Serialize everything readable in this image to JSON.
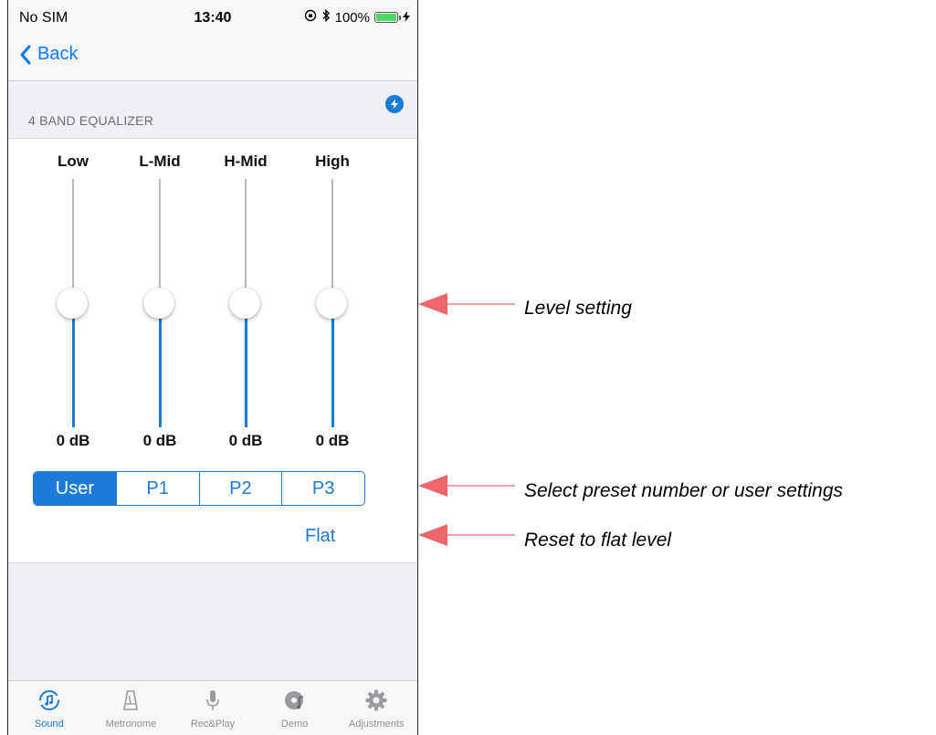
{
  "status_bar": {
    "carrier": "No SIM",
    "time": "13:40",
    "battery": "100%",
    "battery_level": 1.0
  },
  "nav": {
    "back_label": "Back"
  },
  "section": {
    "header": "4 BAND EQUALIZER"
  },
  "bands": [
    {
      "label": "Low",
      "value": "0 dB",
      "level_fraction": 0.5
    },
    {
      "label": "L-Mid",
      "value": "0 dB",
      "level_fraction": 0.5
    },
    {
      "label": "H-Mid",
      "value": "0 dB",
      "level_fraction": 0.5
    },
    {
      "label": "High",
      "value": "0 dB",
      "level_fraction": 0.5
    }
  ],
  "presets": {
    "options": [
      "User",
      "P1",
      "P2",
      "P3"
    ],
    "selected": "User"
  },
  "flat_button": "Flat",
  "tabbar": {
    "items": [
      {
        "label": "Sound",
        "icon": "sound-icon",
        "active": true
      },
      {
        "label": "Metronome",
        "icon": "metronome-icon",
        "active": false
      },
      {
        "label": "Rec&Play",
        "icon": "microphone-icon",
        "active": false
      },
      {
        "label": "Demo",
        "icon": "demo-disc-icon",
        "active": false
      },
      {
        "label": "Adjustments",
        "icon": "gear-icon",
        "active": false
      }
    ]
  },
  "annotations": {
    "level": "Level setting",
    "preset": "Select preset number or user settings",
    "reset": "Reset to flat level"
  },
  "colors": {
    "accent": "#1b7bd6",
    "arrow": "#f0646b",
    "track": "#b8b8b8"
  }
}
